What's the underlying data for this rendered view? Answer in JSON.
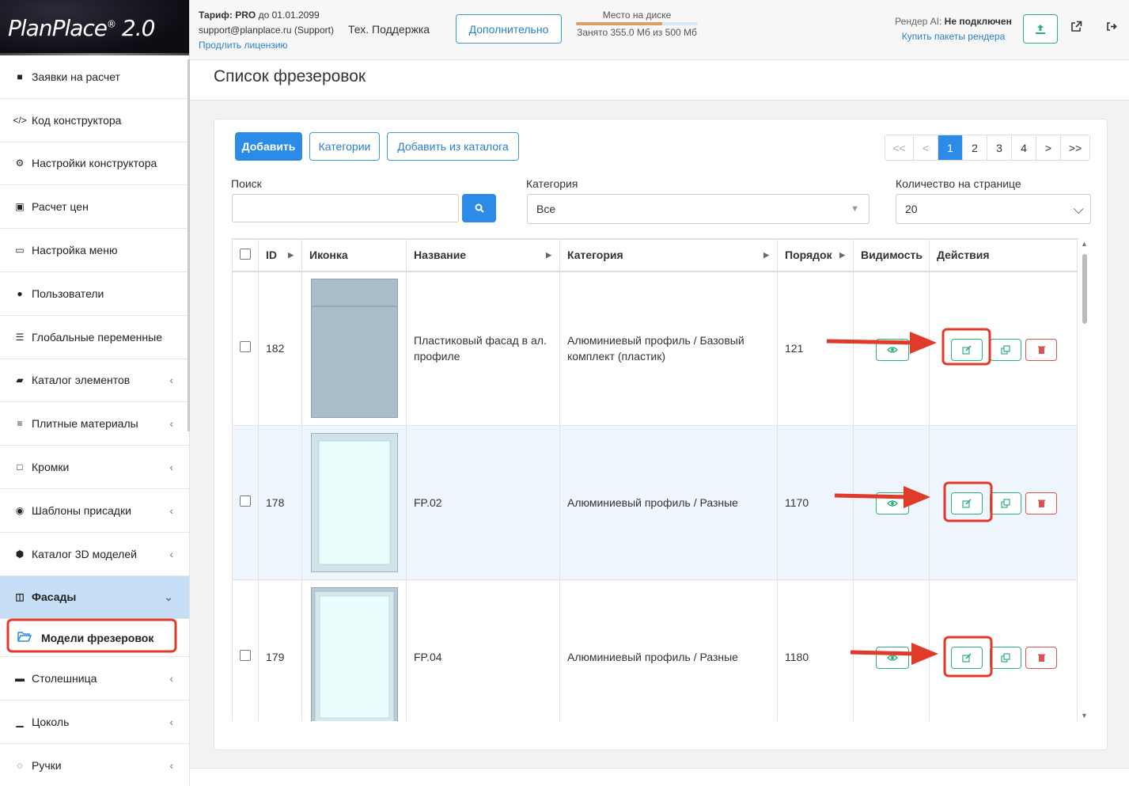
{
  "app": {
    "logo": "PlanPlace",
    "logo_reg": "®",
    "logo_version": "2.0"
  },
  "header": {
    "tariff_label": "Тариф:",
    "tariff_plan": "PRO",
    "tariff_until": "до 01.01.2099",
    "account": "support@planplace.ru (Support)",
    "renew_link": "Продлить лицензию",
    "support": "Тех. Поддержка",
    "more_button": "Дополнительно",
    "disk_label": "Место на диске",
    "disk_used": "Занято 355.0 Мб из 500 Мб",
    "disk_fraction": 0.71,
    "render_label": "Рендер AI:",
    "render_status": "Не подключен",
    "buy_render_link": "Купить пакеты рендера",
    "upload_icon": "upload-icon",
    "external_icon": "external-link-icon",
    "logout_icon": "logout-icon"
  },
  "sidebar": {
    "items": [
      {
        "label": "Заявки на расчет",
        "icon": "■",
        "chev": ""
      },
      {
        "label": "Код конструктора",
        "icon": "</>",
        "chev": ""
      },
      {
        "label": "Настройки конструктора",
        "icon": "⚙",
        "chev": ""
      },
      {
        "label": "Расчет цен",
        "icon": "▣",
        "chev": ""
      },
      {
        "label": "Настройка меню",
        "icon": "▭",
        "chev": ""
      },
      {
        "label": "Пользователи",
        "icon": "●",
        "chev": ""
      },
      {
        "label": "Глобальные переменные",
        "icon": "☰",
        "chev": ""
      },
      {
        "label": "Каталог элементов",
        "icon": "▰",
        "chev": "‹"
      },
      {
        "label": "Плитные материалы",
        "icon": "≡",
        "chev": "‹"
      },
      {
        "label": "Кромки",
        "icon": "□",
        "chev": "‹"
      },
      {
        "label": "Шаблоны присадки",
        "icon": "◉",
        "chev": "‹"
      },
      {
        "label": "Каталог 3D моделей",
        "icon": "⬢",
        "chev": "‹"
      },
      {
        "label": "Фасады",
        "icon": "◫",
        "chev": "⌄"
      }
    ],
    "sub_item": {
      "label": "Модели фрезеровок",
      "icon": "🗁"
    },
    "items_after": [
      {
        "label": "Столешница",
        "icon": "▬",
        "chev": "‹"
      },
      {
        "label": "Цоколь",
        "icon": "▁",
        "chev": "‹"
      },
      {
        "label": "Ручки",
        "icon": "◌",
        "chev": "‹"
      }
    ]
  },
  "main": {
    "title": "Список фрезеровок",
    "add_button": "Добавить",
    "categories_button": "Категории",
    "add_from_catalog_button": "Добавить из каталога",
    "pager": {
      "first": "<<",
      "prev": "<",
      "pages": [
        "1",
        "2",
        "3",
        "4"
      ],
      "next": ">",
      "last": ">>",
      "current": "1"
    },
    "search_label": "Поиск",
    "search_value": "",
    "category_label": "Категория",
    "category_value": "Все",
    "per_page_label": "Количество на странице",
    "per_page_value": "20",
    "columns": [
      "ID",
      "Иконка",
      "Название",
      "Категория",
      "Порядок",
      "Видимость",
      "Действия"
    ],
    "rows": [
      {
        "id": "182",
        "name": "Пластиковый фасад в ал. профиле",
        "category": "Алюминиевый профиль / Базовый комплект (пластик)",
        "order": "121"
      },
      {
        "id": "178",
        "name": "FP.02",
        "category": "Алюминиевый профиль / Разные",
        "order": "1170"
      },
      {
        "id": "179",
        "name": "FP.04",
        "category": "Алюминиевый профиль / Разные",
        "order": "1180"
      }
    ]
  },
  "colors": {
    "primary": "#2b8be6",
    "success": "#2db07a",
    "danger": "#d9534f",
    "highlight": "#e03a2a",
    "active_nav": "#c6dff7"
  }
}
